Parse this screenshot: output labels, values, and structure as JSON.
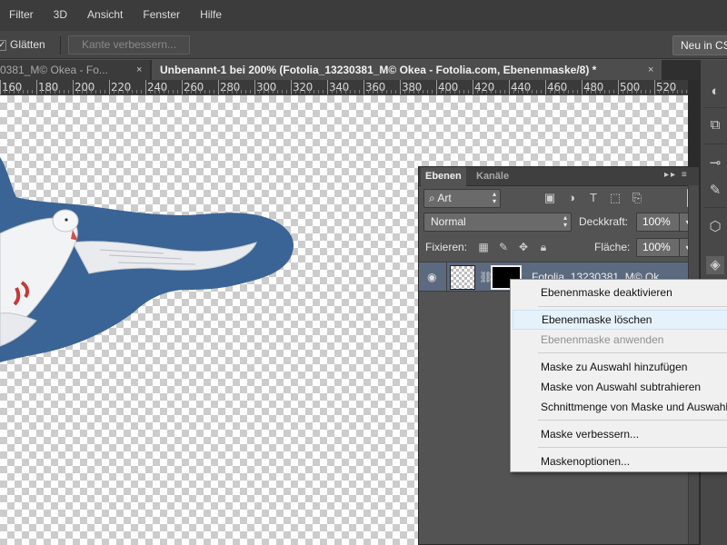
{
  "menubar": {
    "items": [
      "Filter",
      "3D",
      "Ansicht",
      "Fenster",
      "Hilfe"
    ]
  },
  "options": {
    "smooth_label": "Glätten",
    "refine_edge_label": "Kante verbessern...",
    "new_button_label": "Neu in CS"
  },
  "tabs": {
    "inactive_label": "0381_M© Okea - Fo...",
    "active_label": "Unbenannt-1 bei 200% (Fotolia_13230381_M© Okea - Fotolia.com, Ebenenmaske/8) *",
    "close_glyph": "×"
  },
  "ruler": {
    "labels": [
      "160",
      "180",
      "200",
      "220",
      "240",
      "260",
      "280",
      "300",
      "320",
      "340",
      "360",
      "380",
      "400",
      "420",
      "440",
      "460",
      "480",
      "500",
      "520"
    ]
  },
  "layers_panel": {
    "tab_active": "Ebenen",
    "tab_inactive": "Kanäle",
    "menu_glyph": "▸▸ ≡",
    "filter_label": "Art",
    "blend_mode": "Normal",
    "opacity_label": "Deckkraft:",
    "opacity_value": "100%",
    "lock_label": "Fixieren:",
    "fill_label": "Fläche:",
    "fill_value": "100%",
    "layer_name": "Fotolia_13230381_M© Ok"
  },
  "context_menu": {
    "items": [
      {
        "label": "Ebenenmaske deaktivieren",
        "state": "normal"
      },
      {
        "label": "Ebenenmaske löschen",
        "state": "highlight"
      },
      {
        "label": "Ebenenmaske anwenden",
        "state": "disabled"
      },
      {
        "label": "Maske zu Auswahl hinzufügen",
        "state": "normal"
      },
      {
        "label": "Maske von Auswahl subtrahieren",
        "state": "normal"
      },
      {
        "label": "Schnittmenge von Maske und Auswahl",
        "state": "normal"
      },
      {
        "label": "Maske verbessern...",
        "state": "normal"
      },
      {
        "label": "Maskenoptionen...",
        "state": "normal"
      }
    ]
  },
  "colors": {
    "ui_dark": "#3c3c3c",
    "panel": "#535353",
    "layer_selected": "#5b6a7f",
    "mask_blue": "#3a6496",
    "menu_bg": "#f0f0f0",
    "menu_highlight": "#e5f1fb"
  }
}
